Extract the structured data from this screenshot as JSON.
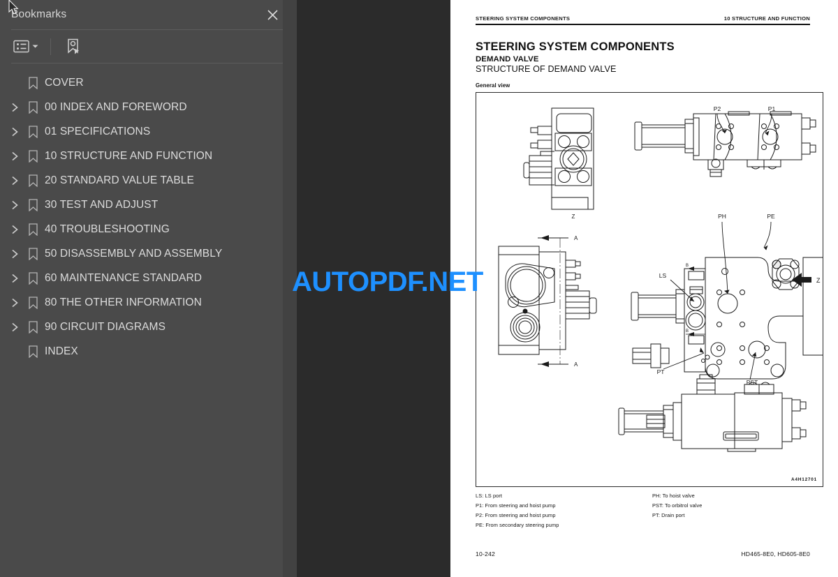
{
  "sidebar": {
    "title": "Bookmarks",
    "close_icon": "close-icon",
    "toolbar": {
      "list_options_label": "list-options-icon",
      "dropdown_label": "chevron-down-icon",
      "find_bookmark_label": "find-bookmark-icon"
    },
    "items": [
      {
        "label": "COVER",
        "expandable": false
      },
      {
        "label": "00 INDEX AND FOREWORD",
        "expandable": true
      },
      {
        "label": "01 SPECIFICATIONS",
        "expandable": true
      },
      {
        "label": "10 STRUCTURE AND FUNCTION",
        "expandable": true
      },
      {
        "label": "20 STANDARD VALUE TABLE",
        "expandable": true
      },
      {
        "label": "30 TEST AND ADJUST",
        "expandable": true
      },
      {
        "label": "40 TROUBLESHOOTING",
        "expandable": true
      },
      {
        "label": "50 DISASSEMBLY AND ASSEMBLY",
        "expandable": true
      },
      {
        "label": "60 MAINTENANCE STANDARD",
        "expandable": true
      },
      {
        "label": "80 THE OTHER INFORMATION",
        "expandable": true
      },
      {
        "label": "90 CIRCUIT DIAGRAMS",
        "expandable": true
      },
      {
        "label": "INDEX",
        "expandable": false
      }
    ]
  },
  "watermark": {
    "text": "AUTOPDF.NET",
    "color": "#1e90ff"
  },
  "page": {
    "header_left": "STEERING SYSTEM COMPONENTS",
    "header_right": "10 STRUCTURE AND FUNCTION",
    "title": "STEERING SYSTEM COMPONENTS",
    "subtitle1": "DEMAND VALVE",
    "subtitle2": "STRUCTURE OF DEMAND VALVE",
    "caption": "General view",
    "figure": {
      "code": "A4H12701",
      "callouts": {
        "p2": "P2",
        "p1": "P1",
        "ph": "PH",
        "pe": "PE",
        "ls": "LS",
        "pt": "PT",
        "pst": "PST",
        "z_top": "Z",
        "z_right": "Z",
        "section_a_top": "A",
        "section_a_bottom": "A",
        "b_upper": "B",
        "b_lower": "B"
      }
    },
    "legend_left": [
      "LS: LS port",
      "P1: From steering and hoist pump",
      "P2: From steering and hoist pump",
      "PE: From secondary steering pump"
    ],
    "legend_right": [
      "PH: To hoist valve",
      "PST: To orbitrol valve",
      "PT: Drain port"
    ],
    "footer_left": "10-242",
    "footer_right": "HD465-8E0, HD605-8E0"
  }
}
